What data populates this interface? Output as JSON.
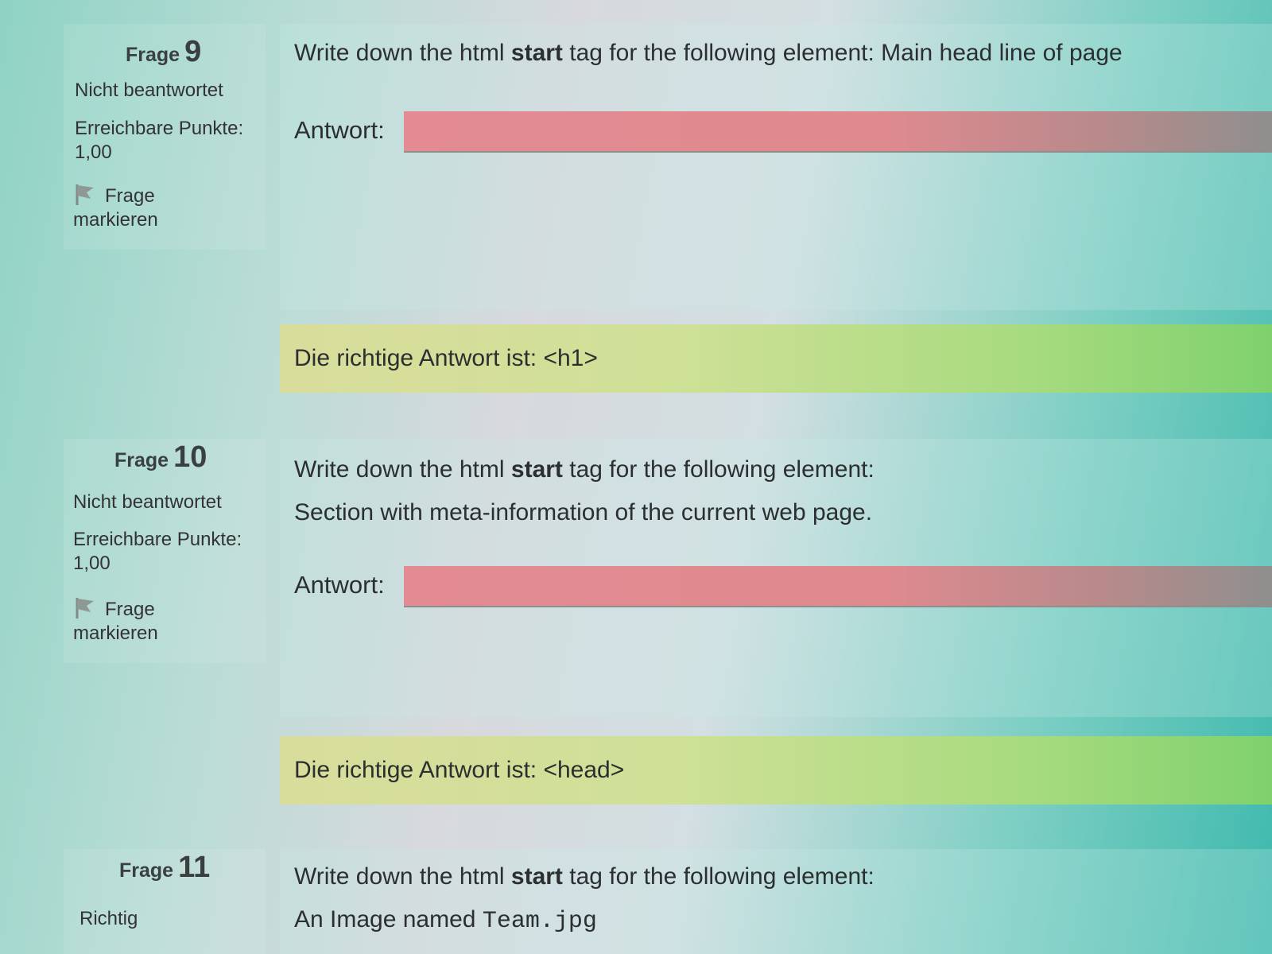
{
  "questions": [
    {
      "label": "Frage",
      "number": "9",
      "state": "Nicht beantwortet",
      "points_label": "Erreichbare Punkte:",
      "points_value": "1,00",
      "flag_label_1": "Frage",
      "flag_label_2": "markieren",
      "text_pre": "Write down the html ",
      "text_bold": "start",
      "text_post": " tag for the following element: Main head line of page",
      "answer_label": "Antwort:",
      "answer_value": "",
      "feedback": "Die richtige Antwort ist: <h1>"
    },
    {
      "label": "Frage",
      "number": "10",
      "state": "Nicht beantwortet",
      "points_label": "Erreichbare Punkte:",
      "points_value": "1,00",
      "flag_label_1": "Frage",
      "flag_label_2": "markieren",
      "text_pre": "Write down the html ",
      "text_bold": "start",
      "text_post": " tag for the following element:",
      "text_line2": "Section with meta-information of the current web page.",
      "answer_label": "Antwort:",
      "answer_value": "",
      "feedback": "Die richtige Antwort ist: <head>"
    },
    {
      "label": "Frage",
      "number": "11",
      "state": "Richtig",
      "text_pre": "Write down the html ",
      "text_bold": "start",
      "text_post": " tag for the following element:",
      "text_line2_pre": "An Image named ",
      "text_line2_code": "Team.jpg"
    }
  ],
  "colors": {
    "incorrect_input": "#e38a92",
    "correct_feedback": "#cfe097",
    "flag_icon": "#7f8a86"
  },
  "icons": {
    "flag": "flag-icon"
  }
}
